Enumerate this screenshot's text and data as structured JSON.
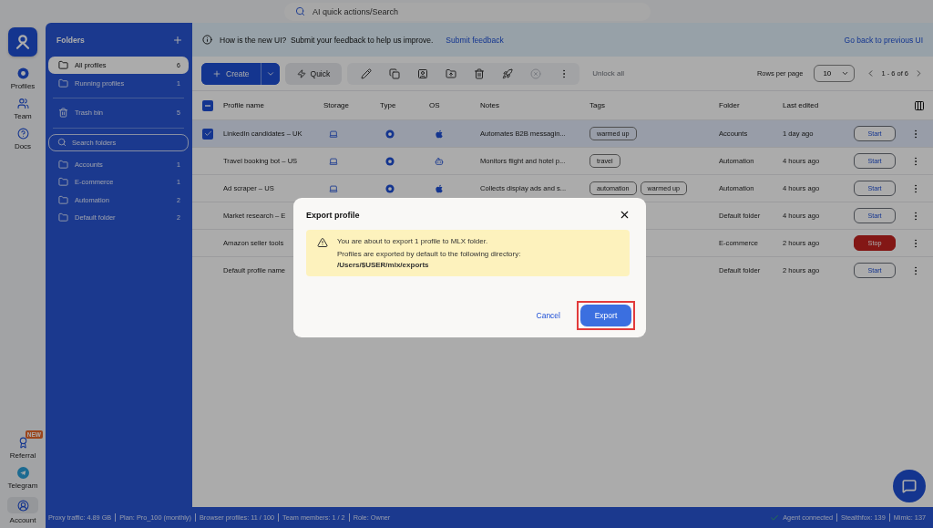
{
  "search": {
    "placeholder": "AI quick actions/Search"
  },
  "rail": [
    {
      "kind": "profiles",
      "label": "Profiles",
      "selected": false
    },
    {
      "kind": "team",
      "label": "Team",
      "selected": false
    },
    {
      "kind": "docs",
      "label": "Docs",
      "selected": false
    },
    {
      "kind": "referral",
      "label": "Referral",
      "badge": "NEW",
      "selected": false
    },
    {
      "kind": "telegram",
      "label": "Telegram",
      "selected": false
    },
    {
      "kind": "account",
      "label": "Account",
      "selected": true
    }
  ],
  "folders": {
    "title": "Folders",
    "top": [
      {
        "kind": "folder",
        "label": "All profiles",
        "count": "6",
        "selected": true
      },
      {
        "kind": "folder",
        "label": "Running profiles",
        "count": "1",
        "selected": false
      }
    ],
    "trash": {
      "kind": "trash",
      "label": "Trash bin",
      "count": "5",
      "selected": false
    },
    "search": {
      "placeholder": "Search folders"
    },
    "items": [
      {
        "kind": "folder",
        "label": "Accounts",
        "count": "1",
        "selected": false
      },
      {
        "kind": "folder",
        "label": "E-commerce",
        "count": "1",
        "selected": false
      },
      {
        "kind": "folder",
        "label": "Automation",
        "count": "2",
        "selected": false
      },
      {
        "kind": "folder",
        "label": "Default folder",
        "count": "2",
        "selected": false
      }
    ]
  },
  "banner": {
    "text": "How is the new UI?  Submit your feedback to help us improve.",
    "link": "Submit feedback",
    "right_link": "Go back to previous UI"
  },
  "toolbar": {
    "create": "Create",
    "quick": "Quick",
    "tools": [
      {
        "kind": "edit",
        "disabled": false
      },
      {
        "kind": "copy",
        "disabled": false
      },
      {
        "kind": "clone",
        "disabled": false
      },
      {
        "kind": "move",
        "disabled": false
      },
      {
        "kind": "delete",
        "disabled": false
      },
      {
        "kind": "launch",
        "disabled": false
      },
      {
        "kind": "stop",
        "disabled": true
      },
      {
        "kind": "more",
        "disabled": false
      }
    ],
    "unlock": {
      "label": "Unlock all",
      "disabled": true
    },
    "rows_per_page": "Rows per page",
    "page_size": "10",
    "range": "1 - 6 of 6"
  },
  "table": {
    "columns": [
      "Profile name",
      "Storage",
      "Type",
      "OS",
      "Notes",
      "Tags",
      "Folder",
      "Last edited"
    ],
    "header_partial": true,
    "rows": [
      {
        "selected": true,
        "kind": "macos",
        "name": "LinkedIn candidates – UK",
        "notes": "Automates B2B messagin...",
        "tags": [
          "warmed up"
        ],
        "folder": "Accounts",
        "last_edited": "1 day ago",
        "action": {
          "label": "Start",
          "kind": "start"
        }
      },
      {
        "selected": false,
        "kind": "linux",
        "name": "Travel booking bot – US",
        "notes": "Monitors flight and hotel p...",
        "tags": [
          "travel"
        ],
        "folder": "Automation",
        "last_edited": "4 hours ago",
        "action": {
          "label": "Start",
          "kind": "start"
        }
      },
      {
        "selected": false,
        "kind": "macos",
        "name": "Ad scraper – US",
        "notes": "Collects display ads and s...",
        "tags": [
          "automation",
          "warmed up"
        ],
        "folder": "Automation",
        "last_edited": "4 hours ago",
        "action": {
          "label": "Start",
          "kind": "start"
        }
      },
      {
        "selected": false,
        "kind": "covered",
        "name": "Market research – E",
        "folder": "Default folder",
        "last_edited": "4 hours ago",
        "action": {
          "label": "Start",
          "kind": "start"
        }
      },
      {
        "selected": false,
        "kind": "covered",
        "name": "Amazon seller tools",
        "folder": "E-commerce",
        "last_edited": "2 hours ago",
        "action": {
          "label": "Stop",
          "kind": "stop"
        }
      },
      {
        "selected": false,
        "kind": "covered",
        "name": "Default profile name",
        "folder": "Default folder",
        "last_edited": "2 hours ago",
        "action": {
          "label": "Start",
          "kind": "start"
        }
      }
    ]
  },
  "status_bar": {
    "left": [
      "Proxy traffic: 4.89 GB",
      "Plan: Pro_100 (monthly)",
      "Browser profiles: 11 / 100",
      "Team members: 1 / 2",
      "Role: Owner"
    ],
    "agent": "Agent connected",
    "right": [
      "Stealthfox: 139",
      "Mimic: 137"
    ]
  },
  "dialog": {
    "title": "Export profile",
    "message": "You are about to export 1 profile to MLX folder.",
    "detail": "Profiles are exported by default to the following directory:",
    "path": "/Users/$USER/mlx/exports",
    "cancel": "Cancel",
    "confirm": {
      "label": "Export",
      "highlighted": true
    }
  }
}
